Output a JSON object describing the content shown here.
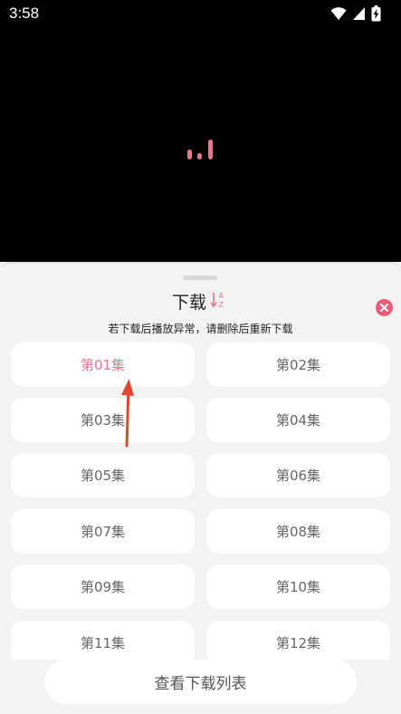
{
  "status_bar": {
    "time": "3:58",
    "icons": [
      "wifi-icon",
      "signal-icon",
      "battery-charging-icon"
    ]
  },
  "player": {
    "state_icon": "loading-bars-icon",
    "accent": "#e8768f"
  },
  "sheet": {
    "title": "下载",
    "sort_icon": "sort-az-icon",
    "close_icon": "close-icon",
    "notice": "若下载后播放异常，请删除后重新下载",
    "episodes": [
      {
        "label": "第01集",
        "active": true
      },
      {
        "label": "第02集",
        "active": false
      },
      {
        "label": "第03集",
        "active": false
      },
      {
        "label": "第04集",
        "active": false
      },
      {
        "label": "第05集",
        "active": false
      },
      {
        "label": "第06集",
        "active": false
      },
      {
        "label": "第07集",
        "active": false
      },
      {
        "label": "第08集",
        "active": false
      },
      {
        "label": "第09集",
        "active": false
      },
      {
        "label": "第10集",
        "active": false
      },
      {
        "label": "第11集",
        "active": false
      },
      {
        "label": "第12集",
        "active": false
      }
    ],
    "view_list_label": "查看下载列表"
  },
  "colors": {
    "accent": "#e8768f",
    "close": "#ea5b7a",
    "annotation_arrow": "#e0472f"
  }
}
